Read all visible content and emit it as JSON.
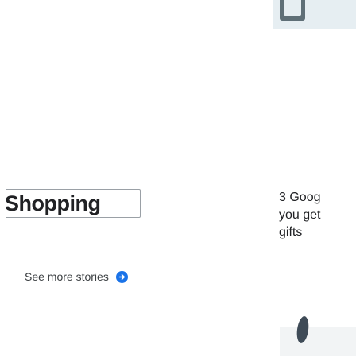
{
  "stories": {
    "chip_label": "Shopping",
    "item": {
      "title_lines": [
        "3 Goog",
        "you get",
        "gifts"
      ]
    },
    "see_more_label": "See more stories",
    "see_more_icon": "arrow-right-circle-icon"
  },
  "colors": {
    "accent": "#1a73e8",
    "text": "#202124",
    "chip_border": "#9aa0a6"
  }
}
